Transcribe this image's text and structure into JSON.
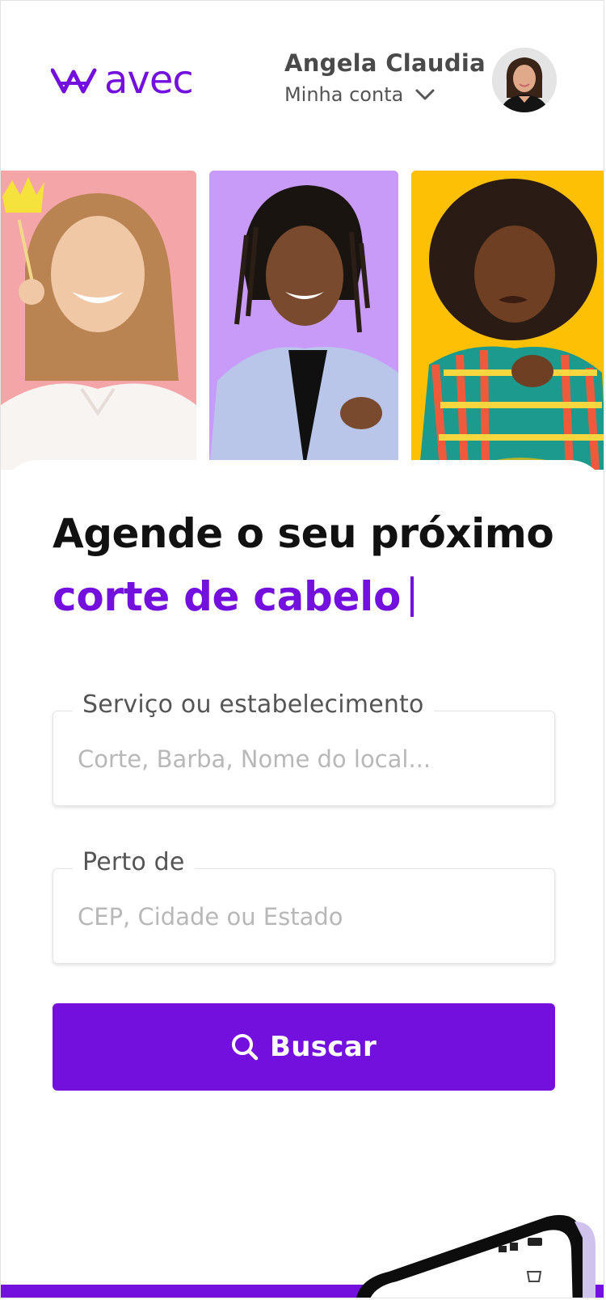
{
  "brand": {
    "name": "avec",
    "color": "#7310dd"
  },
  "account": {
    "user_name": "Angela Claudia",
    "link_label": "Minha conta"
  },
  "hero": {
    "cards": [
      {
        "bg": "#f4a5a8"
      },
      {
        "bg": "#c89bf8"
      },
      {
        "bg": "#fec005"
      }
    ]
  },
  "main": {
    "headline": "Agende o seu próximo",
    "headline_accent": "corte de cabelo",
    "service_field": {
      "label": "Serviço ou estabelecimento",
      "placeholder": "Corte, Barba, Nome do local...",
      "value": ""
    },
    "location_field": {
      "label": "Perto de",
      "placeholder": "CEP, Cidade ou Estado",
      "value": ""
    },
    "search_button": {
      "label": "Buscar",
      "icon": "search-icon"
    }
  },
  "colors": {
    "accent": "#7310dd",
    "text_dark": "#111111",
    "muted": "#555555",
    "placeholder": "#b8b8b8"
  }
}
